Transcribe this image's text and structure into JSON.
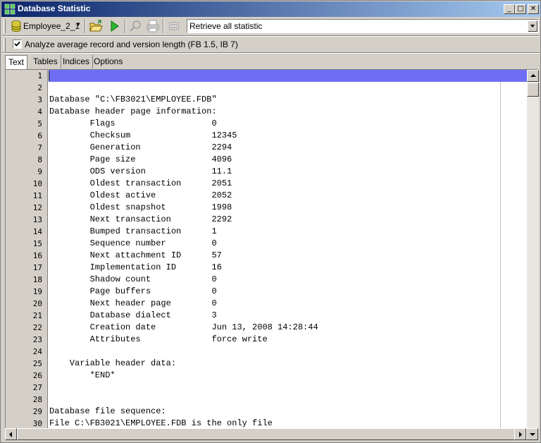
{
  "window": {
    "title": "Database Statistic",
    "controls": {
      "minimize": "_",
      "maximize": "□",
      "close": "✕"
    }
  },
  "toolbar": {
    "database_label": "Employee_2_1",
    "mode_value": "Retrieve all statistic",
    "icons": [
      "database-icon",
      "open-folder-icon",
      "run-icon",
      "find-icon",
      "print-icon",
      "calculator-icon"
    ]
  },
  "options": {
    "analyze_checked": true,
    "analyze_label": "Analyze average record and version length (FB 1.5, IB 7)"
  },
  "tabs": [
    {
      "label": "Text",
      "active": true
    },
    {
      "label": "Tables",
      "active": false
    },
    {
      "label": "Indices",
      "active": false
    },
    {
      "label": "Options",
      "active": false
    }
  ],
  "editor": {
    "current_line": 1,
    "highlight_color": "#6e6ef5",
    "lines": [
      {
        "n": "1",
        "t": ""
      },
      {
        "n": "2",
        "t": ""
      },
      {
        "n": "3",
        "t": "Database \"C:\\FB3021\\EMPLOYEE.FDB\""
      },
      {
        "n": "4",
        "t": "Database header page information:"
      },
      {
        "n": "5",
        "t": "        Flags                   0"
      },
      {
        "n": "6",
        "t": "        Checksum                12345"
      },
      {
        "n": "7",
        "t": "        Generation              2294"
      },
      {
        "n": "8",
        "t": "        Page size               4096"
      },
      {
        "n": "9",
        "t": "        ODS version             11.1"
      },
      {
        "n": "10",
        "t": "        Oldest transaction      2051"
      },
      {
        "n": "11",
        "t": "        Oldest active           2052"
      },
      {
        "n": "12",
        "t": "        Oldest snapshot         1998"
      },
      {
        "n": "13",
        "t": "        Next transaction        2292"
      },
      {
        "n": "14",
        "t": "        Bumped transaction      1"
      },
      {
        "n": "15",
        "t": "        Sequence number         0"
      },
      {
        "n": "16",
        "t": "        Next attachment ID      57"
      },
      {
        "n": "17",
        "t": "        Implementation ID       16"
      },
      {
        "n": "18",
        "t": "        Shadow count            0"
      },
      {
        "n": "19",
        "t": "        Page buffers            0"
      },
      {
        "n": "20",
        "t": "        Next header page        0"
      },
      {
        "n": "21",
        "t": "        Database dialect        3"
      },
      {
        "n": "22",
        "t": "        Creation date           Jun 13, 2008 14:28:44"
      },
      {
        "n": "23",
        "t": "        Attributes              force write"
      },
      {
        "n": "24",
        "t": ""
      },
      {
        "n": "25",
        "t": "    Variable header data:"
      },
      {
        "n": "26",
        "t": "        *END*"
      },
      {
        "n": "27",
        "t": ""
      },
      {
        "n": "28",
        "t": ""
      },
      {
        "n": "29",
        "t": "Database file sequence:"
      },
      {
        "n": "30",
        "t": "File C:\\FB3021\\EMPLOYEE.FDB is the only file"
      }
    ]
  }
}
